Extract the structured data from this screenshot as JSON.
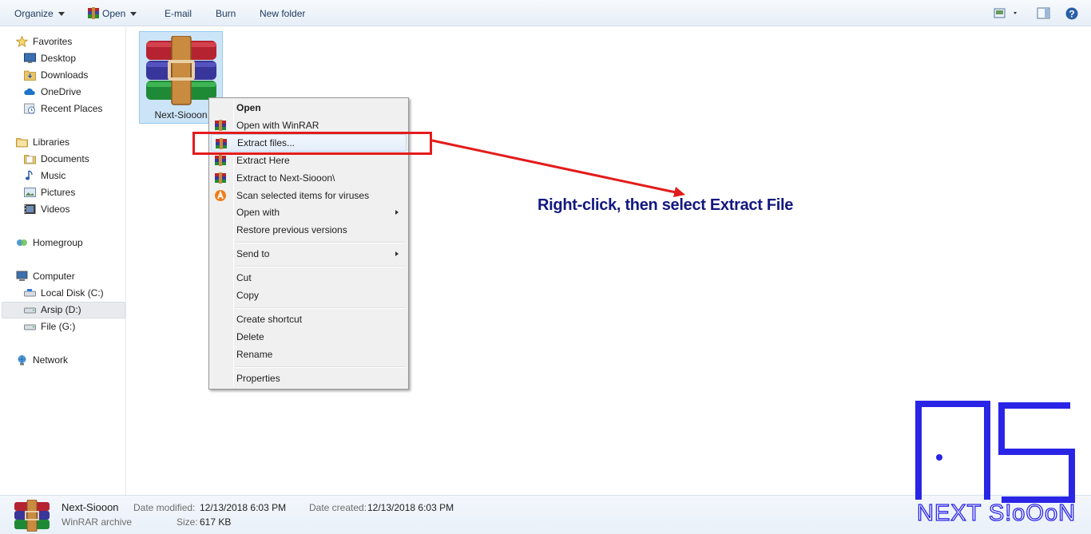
{
  "toolbar": {
    "organize": "Organize",
    "open": "Open",
    "email": "E-mail",
    "burn": "Burn",
    "new_folder": "New folder"
  },
  "nav": {
    "favorites": "Favorites",
    "desktop": "Desktop",
    "downloads": "Downloads",
    "onedrive": "OneDrive",
    "recent_places": "Recent Places",
    "libraries": "Libraries",
    "documents": "Documents",
    "music": "Music",
    "pictures": "Pictures",
    "videos": "Videos",
    "homegroup": "Homegroup",
    "computer": "Computer",
    "local_disk": "Local Disk (C:)",
    "arsip": "Arsip (D:)",
    "file_g": "File (G:)",
    "network": "Network"
  },
  "file": {
    "name": "Next-Siooon",
    "icon": "winrar-archive-icon"
  },
  "context_menu": {
    "open": "Open",
    "open_with_winrar": "Open with WinRAR",
    "extract_files": "Extract files...",
    "extract_here": "Extract Here",
    "extract_to": "Extract to Next-Siooon\\",
    "scan": "Scan selected items for viruses",
    "open_with": "Open with",
    "restore": "Restore previous versions",
    "send_to": "Send to",
    "cut": "Cut",
    "copy": "Copy",
    "create_shortcut": "Create shortcut",
    "delete": "Delete",
    "rename": "Rename",
    "properties": "Properties"
  },
  "annotation": {
    "text": "Right-click, then select Extract File",
    "color": "#131880",
    "arrow_color": "#e41b1b"
  },
  "details": {
    "name": "Next-Siooon",
    "type": "WinRAR archive",
    "date_modified_label": "Date modified:",
    "date_modified": "12/13/2018 6:03 PM",
    "date_created_label": "Date created:",
    "date_created": "12/13/2018 6:03 PM",
    "size_label": "Size:",
    "size": "617 KB"
  },
  "watermark": {
    "text": "NEXT S!oOoN",
    "color": "#2a25e6"
  }
}
